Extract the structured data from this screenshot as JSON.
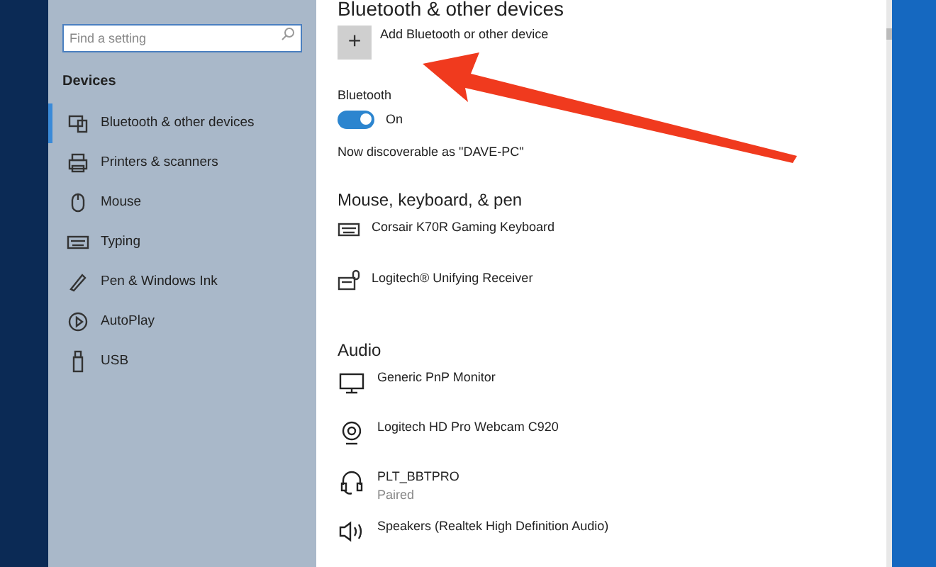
{
  "sidebar": {
    "search": {
      "placeholder": "Find a setting"
    },
    "heading": "Devices",
    "items": [
      {
        "label": "Bluetooth & other devices",
        "kind": "bluetooth",
        "selected": true
      },
      {
        "label": "Printers & scanners",
        "kind": "printer",
        "selected": false
      },
      {
        "label": "Mouse",
        "kind": "mouse",
        "selected": false
      },
      {
        "label": "Typing",
        "kind": "keyboard",
        "selected": false
      },
      {
        "label": "Pen & Windows Ink",
        "kind": "pen",
        "selected": false
      },
      {
        "label": "AutoPlay",
        "kind": "autoplay",
        "selected": false
      },
      {
        "label": "USB",
        "kind": "usb",
        "selected": false
      }
    ]
  },
  "content": {
    "title": "Bluetooth & other devices",
    "add_button": {
      "icon": "+",
      "label": "Add Bluetooth or other device"
    },
    "bluetooth": {
      "label": "Bluetooth",
      "on": true,
      "state_text": "On"
    },
    "discoverable": "Now discoverable as \"DAVE-PC\"",
    "sections": [
      {
        "heading": "Mouse, keyboard, & pen",
        "devices": [
          {
            "name": "Corsair K70R Gaming Keyboard",
            "kind": "keyboard"
          },
          {
            "name": "Logitech® Unifying Receiver",
            "kind": "keyboard-mouse"
          }
        ]
      },
      {
        "heading": "Audio",
        "devices": [
          {
            "name": "Generic PnP Monitor",
            "kind": "monitor"
          },
          {
            "name": "Logitech HD Pro Webcam C920",
            "kind": "webcam"
          },
          {
            "name": "PLT_BBTPRO",
            "status": "Paired",
            "kind": "headset"
          },
          {
            "name": "Speakers (Realtek High Definition Audio)",
            "kind": "speaker"
          }
        ]
      }
    ]
  }
}
